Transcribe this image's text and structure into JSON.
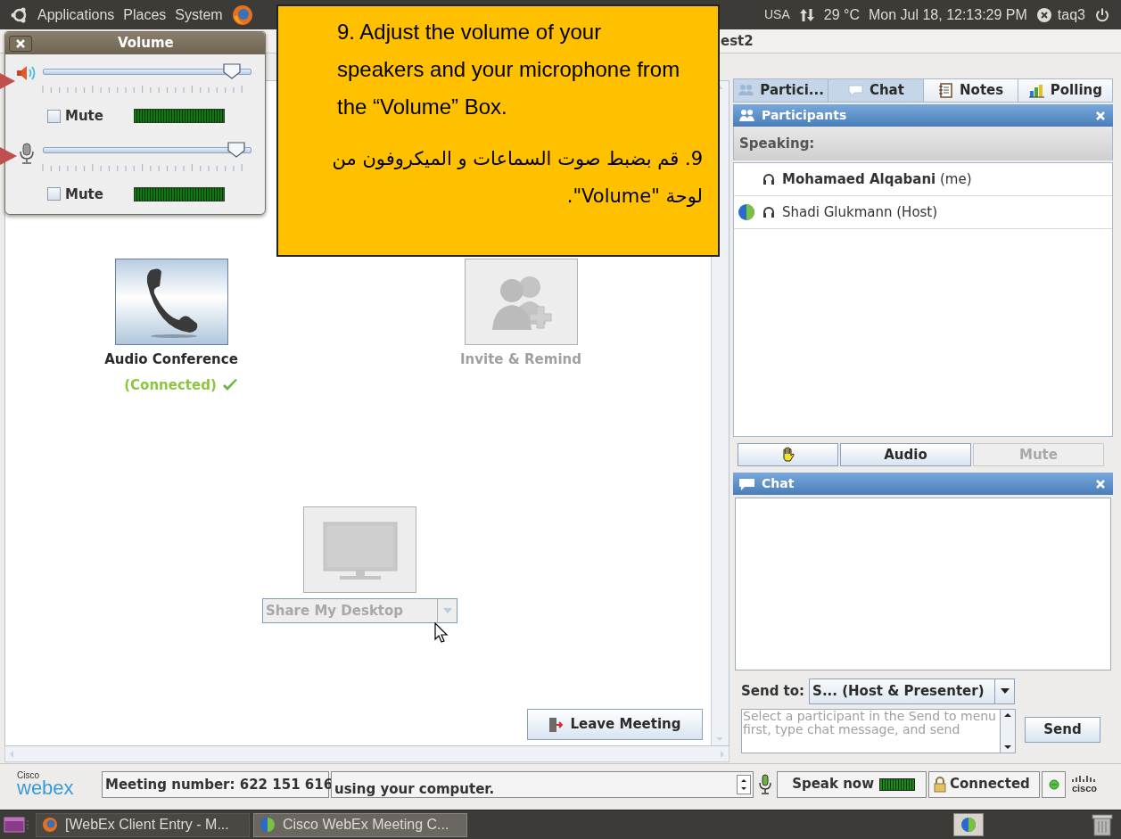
{
  "top_panel": {
    "menus": [
      "Applications",
      "Places",
      "System"
    ],
    "keyboard": "USA",
    "temperature": "29 °C",
    "clock": "Mon Jul 18, 12:13:29 PM",
    "user": "taq3"
  },
  "window": {
    "title": "est2"
  },
  "volume": {
    "title": "Volume",
    "channels": [
      {
        "kind": "speaker",
        "level": 0.92,
        "mute_label": "Mute",
        "muted": false
      },
      {
        "kind": "microphone",
        "level": 0.94,
        "mute_label": "Mute",
        "muted": false
      }
    ]
  },
  "callout": {
    "text_en": "9. Adjust the volume of your speakers and your microphone from the “Volume” Box.",
    "text_ar": "9. قم بضبط صوت السماعات و الميكروفون من لوحة \"Volume\"."
  },
  "actions": [
    {
      "kind": "audio",
      "label": "Audio Conference",
      "status": "(Connected)",
      "disabled": false
    },
    {
      "kind": "invite",
      "label": "Invite & Remind",
      "disabled": true
    }
  ],
  "share": {
    "label": "Share My Desktop",
    "disabled": true
  },
  "leave_button": "Leave Meeting",
  "panel_tabs": [
    {
      "kind": "participants",
      "label": "Partici...",
      "active": true
    },
    {
      "kind": "chat",
      "label": "Chat",
      "active": true
    },
    {
      "kind": "notes",
      "label": "Notes",
      "active": false
    },
    {
      "kind": "polling",
      "label": "Polling",
      "active": false
    }
  ],
  "participants": {
    "title": "Participants",
    "speaking_label": "Speaking:",
    "rows": [
      {
        "name": "**Mohamaed Alqabani** (me)",
        "globe": false
      },
      {
        "name": "Shadi Glukmann (Host)",
        "globe": true
      }
    ],
    "buttons": [
      {
        "kind": "hand",
        "disabled": false
      },
      {
        "kind": "text",
        "label": "Audio",
        "disabled": false
      },
      {
        "kind": "text",
        "label": "Mute",
        "disabled": true
      }
    ]
  },
  "chat": {
    "title": "Chat",
    "send_to_label": "Send to:",
    "send_to": "S... (Host & Presenter)",
    "placeholder": "Select a participant in the Send to menu first, type chat message, and send",
    "send_button": "Send"
  },
  "status_bar": {
    "brand_small": "Cisco",
    "brand": "webex",
    "meeting_number": "Meeting number: 622 151 616",
    "message": "using your computer.",
    "speak": "Speak now",
    "connection": "Connected",
    "cisco": "cisco"
  },
  "taskbar": [
    {
      "kind": "firefox",
      "label": "[WebEx Client Entry - M...",
      "selected": false
    },
    {
      "kind": "webex",
      "label": "Cisco WebEx Meeting C...",
      "selected": true
    }
  ]
}
